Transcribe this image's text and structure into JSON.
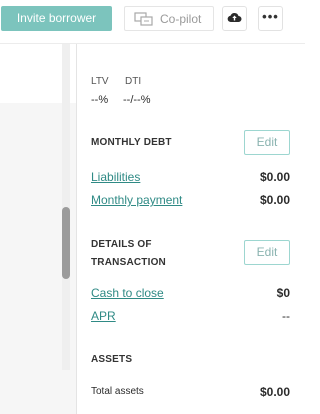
{
  "toolbar": {
    "invite_label": "Invite borrower",
    "copilot_label": "Co-pilot",
    "upload_icon": "cloud-upload-icon",
    "more_label": "•••"
  },
  "ratios": {
    "ltv_label": "LTV",
    "ltv_value": "--%",
    "dti_label": "DTI",
    "dti_value": "--/--%"
  },
  "monthly_debt": {
    "heading": "MONTHLY DEBT",
    "edit_label": "Edit",
    "rows": [
      {
        "label": "Liabilities",
        "value": "$0.00"
      },
      {
        "label": "Monthly payment",
        "value": "$0.00"
      }
    ]
  },
  "transaction": {
    "heading_line1": "DETAILS OF",
    "heading_line2": "TRANSACTION",
    "edit_label": "Edit",
    "rows": [
      {
        "label": "Cash to close",
        "value": "$0"
      },
      {
        "label": "APR",
        "value": "--"
      }
    ]
  },
  "assets": {
    "heading": "ASSETS",
    "total_label": "Total assets",
    "total_value": "$0.00"
  },
  "colors": {
    "accent": "#7cc4bd",
    "link": "#2f8a85",
    "edit_border": "#9dd6d0"
  }
}
